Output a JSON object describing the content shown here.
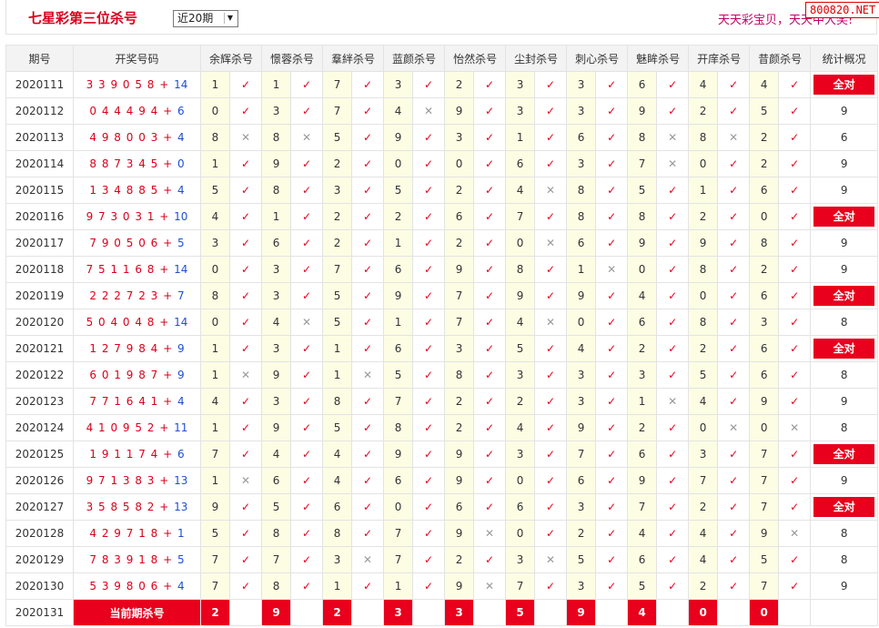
{
  "header": {
    "title": "七星彩第三位杀号",
    "period_select": "近20期",
    "slogan": "天天彩宝贝，天天中大奖!",
    "watermark": "800820.NET"
  },
  "table": {
    "columns": [
      "期号",
      "开奖号码",
      "余辉杀号",
      "憬蓉杀号",
      "羣絆杀号",
      "蓝颜杀号",
      "怡然杀号",
      "尘封杀号",
      "刺心杀号",
      "魅眸杀号",
      "开庠杀号",
      "昔颜杀号",
      "统计概况"
    ],
    "all_right_label": "全对",
    "ok_mark": "✓",
    "bad_mark": "✕",
    "rows": [
      {
        "period": "2020111",
        "digits": "339058",
        "plus": "+",
        "bonus": "14",
        "kills": [
          [
            "1",
            true
          ],
          [
            "1",
            true
          ],
          [
            "7",
            true
          ],
          [
            "3",
            true
          ],
          [
            "2",
            true
          ],
          [
            "3",
            true
          ],
          [
            "3",
            true
          ],
          [
            "6",
            true
          ],
          [
            "4",
            true
          ],
          [
            "4",
            true
          ]
        ],
        "stat": "全对"
      },
      {
        "period": "2020112",
        "digits": "044494",
        "plus": "+",
        "bonus": "6",
        "kills": [
          [
            "0",
            true
          ],
          [
            "3",
            true
          ],
          [
            "7",
            true
          ],
          [
            "4",
            false
          ],
          [
            "9",
            true
          ],
          [
            "3",
            true
          ],
          [
            "3",
            true
          ],
          [
            "9",
            true
          ],
          [
            "2",
            true
          ],
          [
            "5",
            true
          ]
        ],
        "stat": "9"
      },
      {
        "period": "2020113",
        "digits": "498003",
        "plus": "+",
        "bonus": "4",
        "kills": [
          [
            "8",
            false
          ],
          [
            "8",
            false
          ],
          [
            "5",
            true
          ],
          [
            "9",
            true
          ],
          [
            "3",
            true
          ],
          [
            "1",
            true
          ],
          [
            "6",
            true
          ],
          [
            "8",
            false
          ],
          [
            "8",
            false
          ],
          [
            "2",
            true
          ]
        ],
        "stat": "6"
      },
      {
        "period": "2020114",
        "digits": "887345",
        "plus": "+",
        "bonus": "0",
        "kills": [
          [
            "1",
            true
          ],
          [
            "9",
            true
          ],
          [
            "2",
            true
          ],
          [
            "0",
            true
          ],
          [
            "0",
            true
          ],
          [
            "6",
            true
          ],
          [
            "3",
            true
          ],
          [
            "7",
            false
          ],
          [
            "0",
            true
          ],
          [
            "2",
            true
          ]
        ],
        "stat": "9"
      },
      {
        "period": "2020115",
        "digits": "134885",
        "plus": "+",
        "bonus": "4",
        "kills": [
          [
            "5",
            true
          ],
          [
            "8",
            true
          ],
          [
            "3",
            true
          ],
          [
            "5",
            true
          ],
          [
            "2",
            true
          ],
          [
            "4",
            false
          ],
          [
            "8",
            true
          ],
          [
            "5",
            true
          ],
          [
            "1",
            true
          ],
          [
            "6",
            true
          ]
        ],
        "stat": "9"
      },
      {
        "period": "2020116",
        "digits": "973031",
        "plus": "+",
        "bonus": "10",
        "kills": [
          [
            "4",
            true
          ],
          [
            "1",
            true
          ],
          [
            "2",
            true
          ],
          [
            "2",
            true
          ],
          [
            "6",
            true
          ],
          [
            "7",
            true
          ],
          [
            "8",
            true
          ],
          [
            "8",
            true
          ],
          [
            "2",
            true
          ],
          [
            "0",
            true
          ]
        ],
        "stat": "全对"
      },
      {
        "period": "2020117",
        "digits": "790506",
        "plus": "+",
        "bonus": "5",
        "kills": [
          [
            "3",
            true
          ],
          [
            "6",
            true
          ],
          [
            "2",
            true
          ],
          [
            "1",
            true
          ],
          [
            "2",
            true
          ],
          [
            "0",
            false
          ],
          [
            "6",
            true
          ],
          [
            "9",
            true
          ],
          [
            "9",
            true
          ],
          [
            "8",
            true
          ]
        ],
        "stat": "9"
      },
      {
        "period": "2020118",
        "digits": "751168",
        "plus": "+",
        "bonus": "14",
        "kills": [
          [
            "0",
            true
          ],
          [
            "3",
            true
          ],
          [
            "7",
            true
          ],
          [
            "6",
            true
          ],
          [
            "9",
            true
          ],
          [
            "8",
            true
          ],
          [
            "1",
            false
          ],
          [
            "0",
            true
          ],
          [
            "8",
            true
          ],
          [
            "2",
            true
          ]
        ],
        "stat": "9"
      },
      {
        "period": "2020119",
        "digits": "222723",
        "plus": "+",
        "bonus": "7",
        "kills": [
          [
            "8",
            true
          ],
          [
            "3",
            true
          ],
          [
            "5",
            true
          ],
          [
            "9",
            true
          ],
          [
            "7",
            true
          ],
          [
            "9",
            true
          ],
          [
            "9",
            true
          ],
          [
            "4",
            true
          ],
          [
            "0",
            true
          ],
          [
            "6",
            true
          ]
        ],
        "stat": "全对"
      },
      {
        "period": "2020120",
        "digits": "504048",
        "plus": "+",
        "bonus": "14",
        "kills": [
          [
            "0",
            true
          ],
          [
            "4",
            false
          ],
          [
            "5",
            true
          ],
          [
            "1",
            true
          ],
          [
            "7",
            true
          ],
          [
            "4",
            false
          ],
          [
            "0",
            true
          ],
          [
            "6",
            true
          ],
          [
            "8",
            true
          ],
          [
            "3",
            true
          ]
        ],
        "stat": "8"
      },
      {
        "period": "2020121",
        "digits": "127984",
        "plus": "+",
        "bonus": "9",
        "kills": [
          [
            "1",
            true
          ],
          [
            "3",
            true
          ],
          [
            "1",
            true
          ],
          [
            "6",
            true
          ],
          [
            "3",
            true
          ],
          [
            "5",
            true
          ],
          [
            "4",
            true
          ],
          [
            "2",
            true
          ],
          [
            "2",
            true
          ],
          [
            "6",
            true
          ]
        ],
        "stat": "全对"
      },
      {
        "period": "2020122",
        "digits": "601987",
        "plus": "+",
        "bonus": "9",
        "kills": [
          [
            "1",
            false
          ],
          [
            "9",
            true
          ],
          [
            "1",
            false
          ],
          [
            "5",
            true
          ],
          [
            "8",
            true
          ],
          [
            "3",
            true
          ],
          [
            "3",
            true
          ],
          [
            "3",
            true
          ],
          [
            "5",
            true
          ],
          [
            "6",
            true
          ]
        ],
        "stat": "8"
      },
      {
        "period": "2020123",
        "digits": "771641",
        "plus": "+",
        "bonus": "4",
        "kills": [
          [
            "4",
            true
          ],
          [
            "3",
            true
          ],
          [
            "8",
            true
          ],
          [
            "7",
            true
          ],
          [
            "2",
            true
          ],
          [
            "2",
            true
          ],
          [
            "3",
            true
          ],
          [
            "1",
            false
          ],
          [
            "4",
            true
          ],
          [
            "9",
            true
          ]
        ],
        "stat": "9"
      },
      {
        "period": "2020124",
        "digits": "410952",
        "plus": "+",
        "bonus": "11",
        "kills": [
          [
            "1",
            true
          ],
          [
            "9",
            true
          ],
          [
            "5",
            true
          ],
          [
            "8",
            true
          ],
          [
            "2",
            true
          ],
          [
            "4",
            true
          ],
          [
            "9",
            true
          ],
          [
            "2",
            true
          ],
          [
            "0",
            false
          ],
          [
            "0",
            false
          ]
        ],
        "stat": "8"
      },
      {
        "period": "2020125",
        "digits": "191174",
        "plus": "+",
        "bonus": "6",
        "kills": [
          [
            "7",
            true
          ],
          [
            "4",
            true
          ],
          [
            "4",
            true
          ],
          [
            "9",
            true
          ],
          [
            "9",
            true
          ],
          [
            "3",
            true
          ],
          [
            "7",
            true
          ],
          [
            "6",
            true
          ],
          [
            "3",
            true
          ],
          [
            "7",
            true
          ]
        ],
        "stat": "全对"
      },
      {
        "period": "2020126",
        "digits": "971383",
        "plus": "+",
        "bonus": "13",
        "kills": [
          [
            "1",
            false
          ],
          [
            "6",
            true
          ],
          [
            "4",
            true
          ],
          [
            "6",
            true
          ],
          [
            "9",
            true
          ],
          [
            "0",
            true
          ],
          [
            "6",
            true
          ],
          [
            "9",
            true
          ],
          [
            "7",
            true
          ],
          [
            "7",
            true
          ]
        ],
        "stat": "9"
      },
      {
        "period": "2020127",
        "digits": "358582",
        "plus": "+",
        "bonus": "13",
        "kills": [
          [
            "9",
            true
          ],
          [
            "5",
            true
          ],
          [
            "6",
            true
          ],
          [
            "0",
            true
          ],
          [
            "6",
            true
          ],
          [
            "6",
            true
          ],
          [
            "3",
            true
          ],
          [
            "7",
            true
          ],
          [
            "2",
            true
          ],
          [
            "7",
            true
          ]
        ],
        "stat": "全对"
      },
      {
        "period": "2020128",
        "digits": "429718",
        "plus": "+",
        "bonus": "1",
        "kills": [
          [
            "5",
            true
          ],
          [
            "8",
            true
          ],
          [
            "8",
            true
          ],
          [
            "7",
            true
          ],
          [
            "9",
            false
          ],
          [
            "0",
            true
          ],
          [
            "2",
            true
          ],
          [
            "4",
            true
          ],
          [
            "4",
            true
          ],
          [
            "9",
            false
          ]
        ],
        "stat": "8"
      },
      {
        "period": "2020129",
        "digits": "783918",
        "plus": "+",
        "bonus": "5",
        "kills": [
          [
            "7",
            true
          ],
          [
            "7",
            true
          ],
          [
            "3",
            false
          ],
          [
            "7",
            true
          ],
          [
            "2",
            true
          ],
          [
            "3",
            false
          ],
          [
            "5",
            true
          ],
          [
            "6",
            true
          ],
          [
            "4",
            true
          ],
          [
            "5",
            true
          ]
        ],
        "stat": "8"
      },
      {
        "period": "2020130",
        "digits": "539806",
        "plus": "+",
        "bonus": "4",
        "kills": [
          [
            "7",
            true
          ],
          [
            "8",
            true
          ],
          [
            "1",
            true
          ],
          [
            "1",
            true
          ],
          [
            "9",
            false
          ],
          [
            "7",
            true
          ],
          [
            "3",
            true
          ],
          [
            "5",
            true
          ],
          [
            "2",
            true
          ],
          [
            "7",
            true
          ]
        ],
        "stat": "9"
      }
    ],
    "current": {
      "period": "2020131",
      "label": "当前期杀号",
      "picks": [
        "2",
        "9",
        "2",
        "3",
        "3",
        "5",
        "9",
        "4",
        "0",
        "0"
      ]
    }
  }
}
